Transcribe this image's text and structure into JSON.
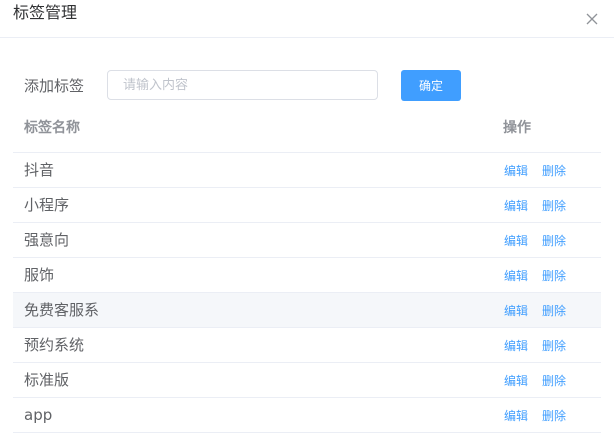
{
  "dialog": {
    "title": "标签管理",
    "close_icon": "close-icon"
  },
  "add": {
    "label": "添加标签",
    "placeholder": "请输入内容",
    "value": "",
    "confirm_label": "确定"
  },
  "table": {
    "columns": [
      "标签名称",
      "操作"
    ],
    "edit_label": "编辑",
    "delete_label": "删除",
    "rows": [
      {
        "name": "抖音"
      },
      {
        "name": "小程序"
      },
      {
        "name": "强意向"
      },
      {
        "name": "服饰"
      },
      {
        "name": "免费客服系"
      },
      {
        "name": "预约系统"
      },
      {
        "name": "标准版"
      },
      {
        "name": "app"
      }
    ]
  },
  "colors": {
    "primary": "#409eff",
    "row_highlight": "#f5f7fa"
  }
}
